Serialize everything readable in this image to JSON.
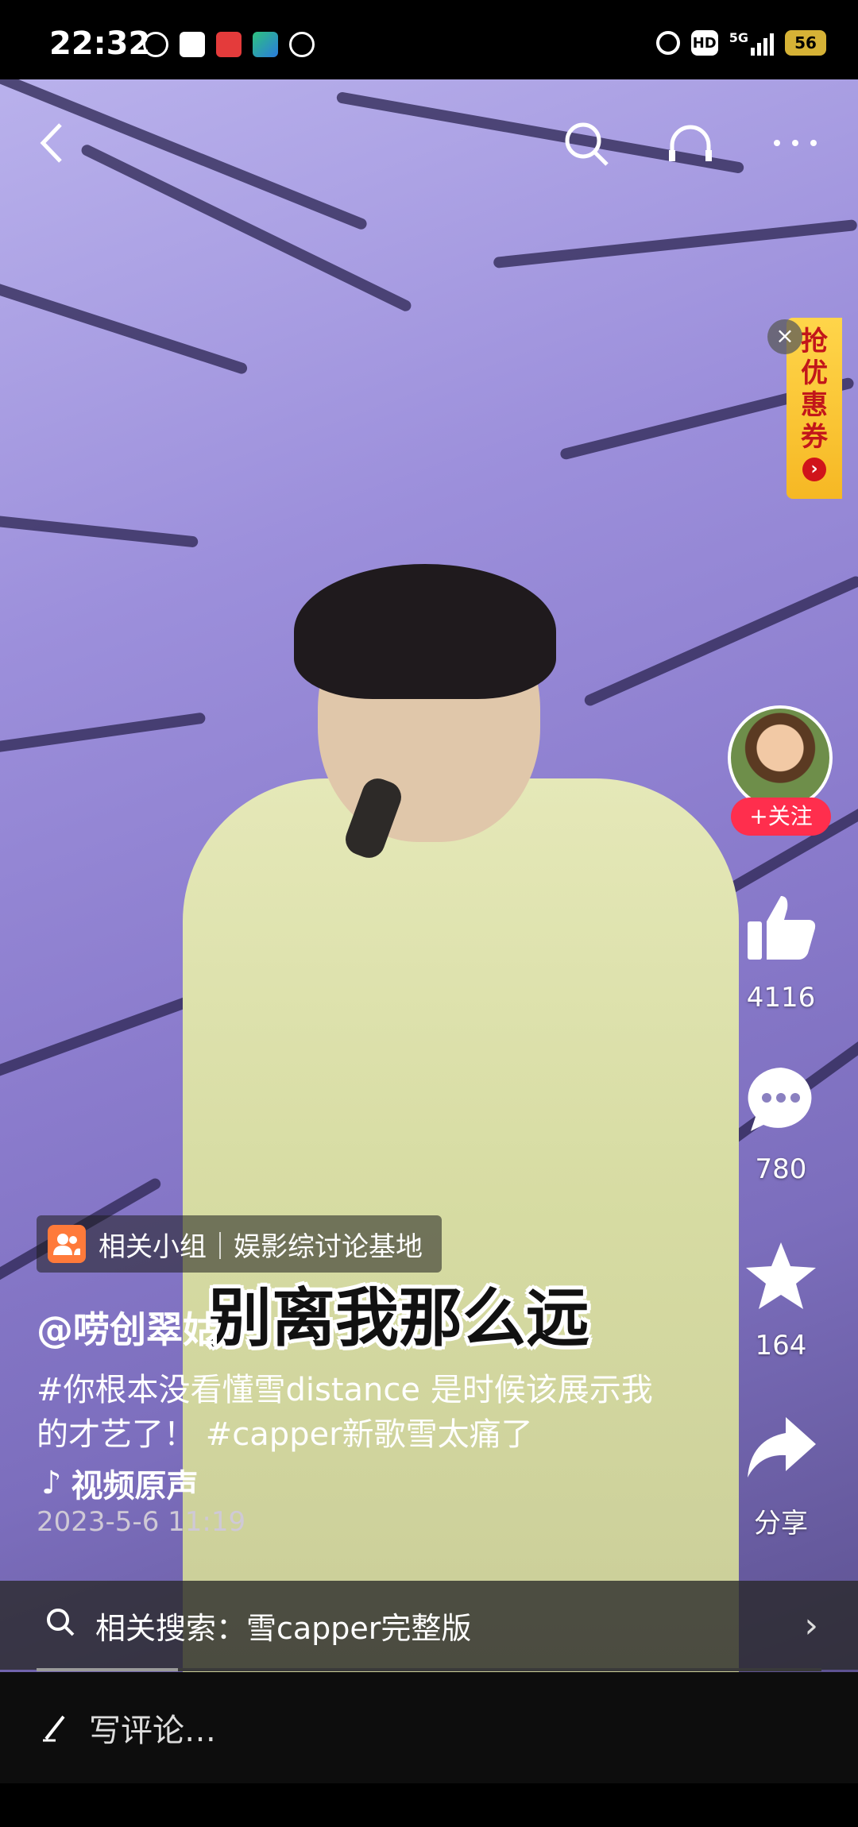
{
  "status_bar": {
    "time": "22:32",
    "hd": "HD",
    "network": "5G",
    "battery": "56"
  },
  "top_bar": {
    "back_icon": "back-arrow-icon",
    "search_icon": "search-icon",
    "headphone_icon": "headphones-icon",
    "more_icon": "more-icon"
  },
  "coupon": {
    "text": "抢优惠券"
  },
  "creator": {
    "follow_label": "+关注"
  },
  "actions": {
    "likes": "4116",
    "comments": "780",
    "favorites": "164",
    "share_label": "分享"
  },
  "group": {
    "label": "相关小组｜娱影综讨论基地"
  },
  "video": {
    "username": "@唠创翠姑",
    "description": "#你根本没看懂雪distance 是时候该展示我的才艺了！ #capper新歌雪太痛了",
    "sound": "视频原声",
    "date": "2023-5-6 11:19",
    "subtitle": "别离我那么远"
  },
  "related_search": {
    "label": "相关搜索：雪capper完整版"
  },
  "comment": {
    "placeholder": "写评论…"
  },
  "colors": {
    "follow": "#ff2e4d",
    "coupon": "#ffd54a",
    "group_icon": "#ff7a3a"
  },
  "progress": {
    "played_fraction": 0.18
  }
}
